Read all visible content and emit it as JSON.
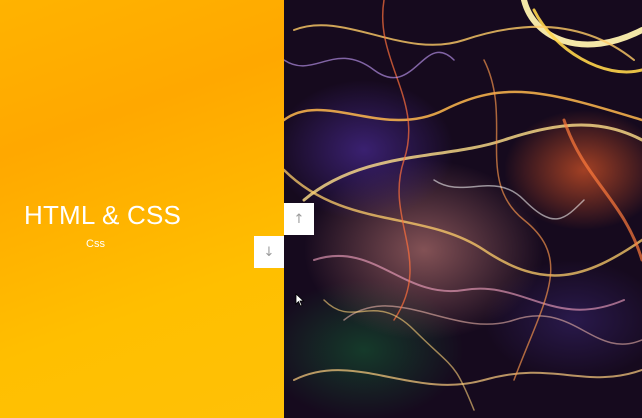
{
  "slide": {
    "title": "HTML & CSS",
    "subtitle": "Css"
  },
  "controls": {
    "up_icon": "arrow-up-icon",
    "down_icon": "arrow-down-icon",
    "up_glyph": "↑",
    "down_glyph": "↓"
  },
  "colors": {
    "panel_accent": "#ffb300",
    "button_bg": "#ffffff",
    "button_icon": "#9a9a9a"
  }
}
